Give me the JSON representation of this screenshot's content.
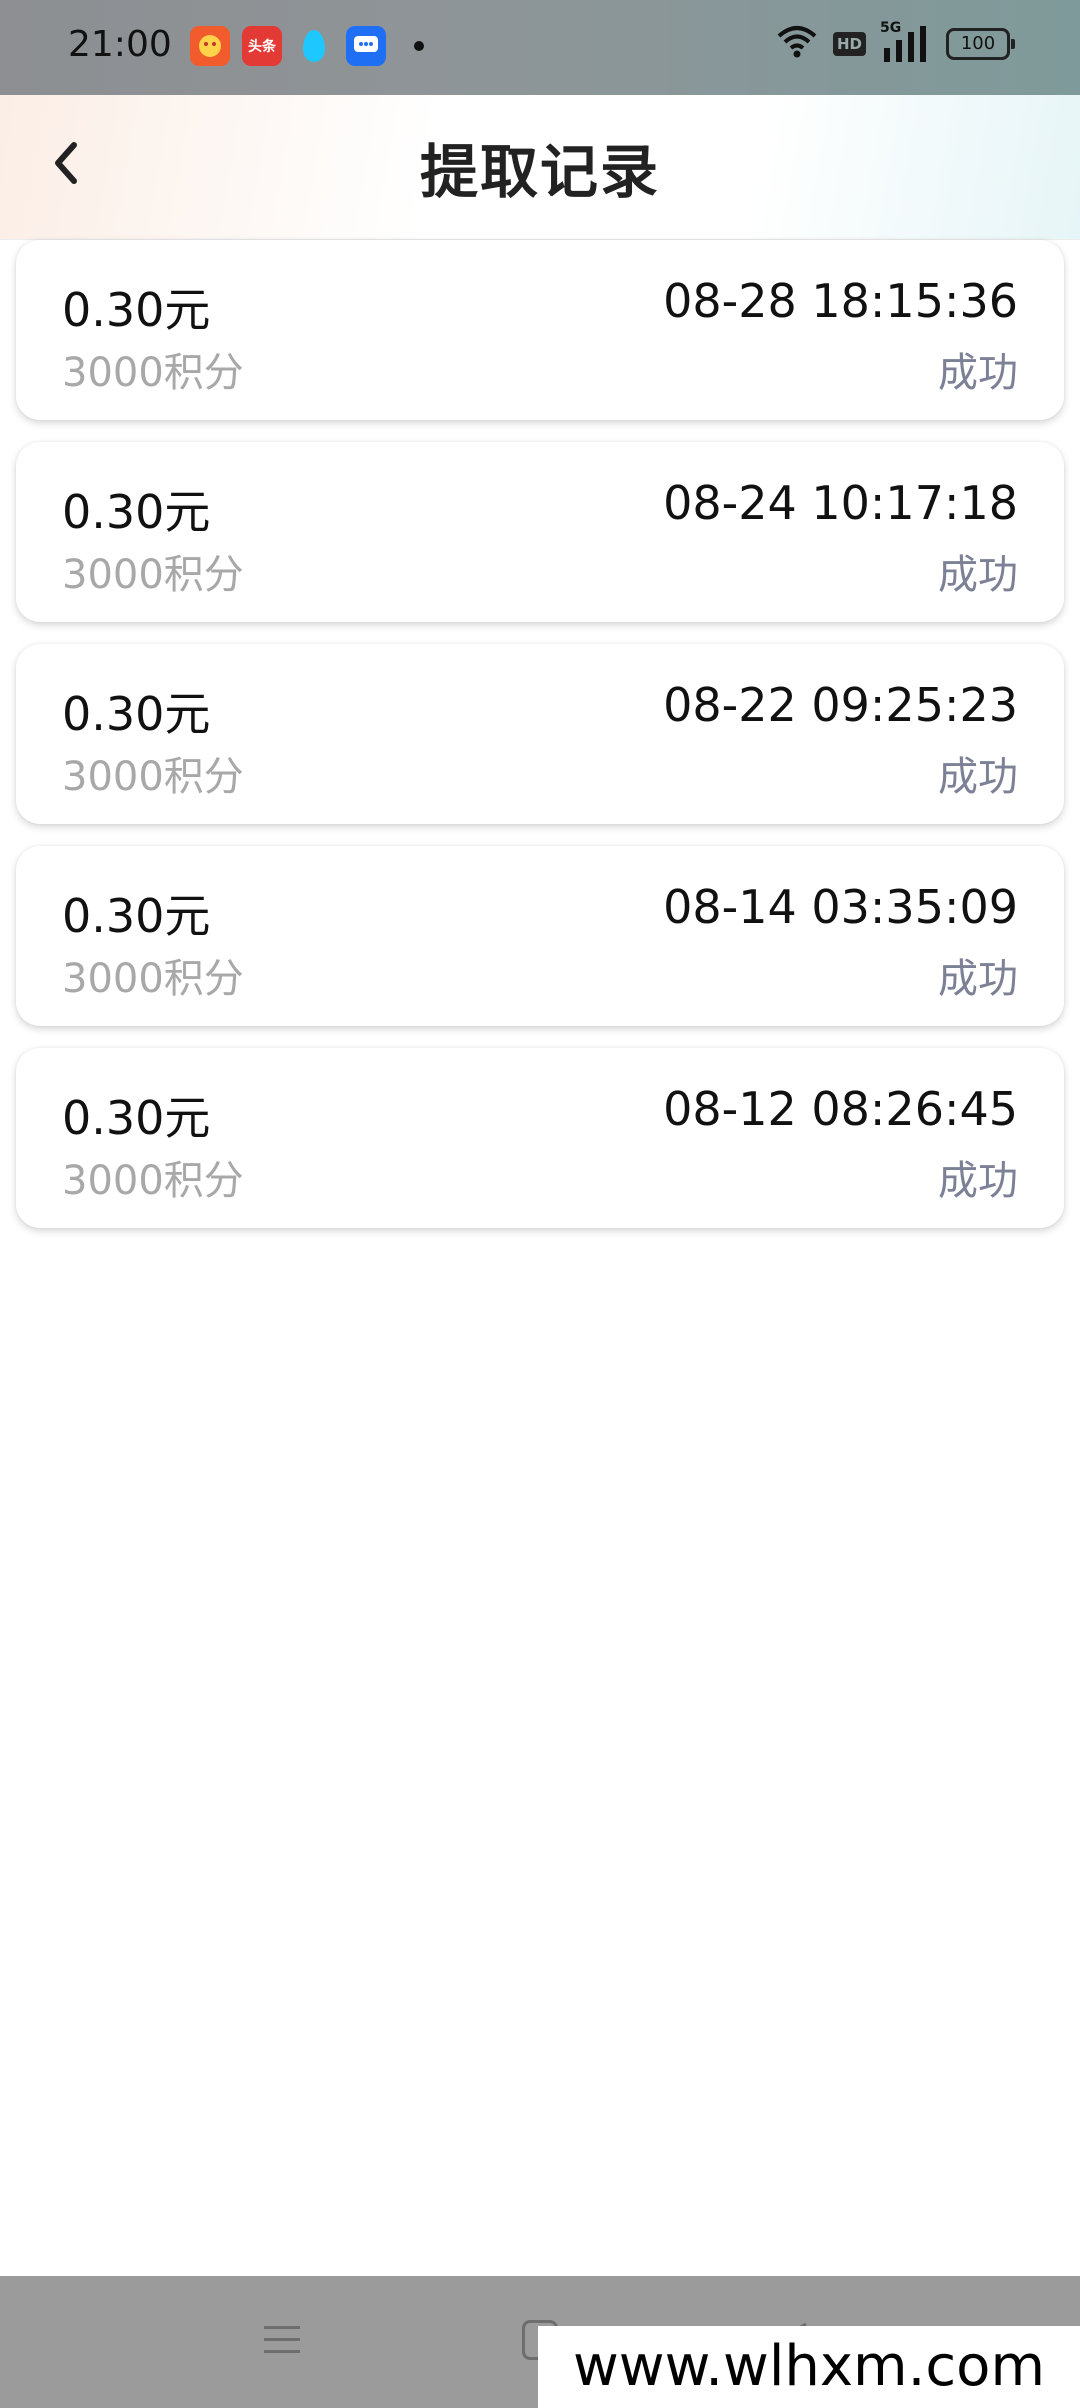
{
  "status_bar": {
    "time": "21:00",
    "notif_apps": [
      "app-icon",
      "toutiao-icon",
      "water-drop-icon",
      "message-icon"
    ],
    "app2_label": "头条",
    "hd": "HD",
    "network": "5G",
    "battery": "100"
  },
  "header": {
    "title": "提取记录",
    "back_icon": "chevron-left-icon"
  },
  "records": [
    {
      "amount": "0.30元",
      "points": "3000积分",
      "datetime": "08-28 18:15:36",
      "status": "成功"
    },
    {
      "amount": "0.30元",
      "points": "3000积分",
      "datetime": "08-24 10:17:18",
      "status": "成功"
    },
    {
      "amount": "0.30元",
      "points": "3000积分",
      "datetime": "08-22 09:25:23",
      "status": "成功"
    },
    {
      "amount": "0.30元",
      "points": "3000积分",
      "datetime": "08-14 03:35:09",
      "status": "成功"
    },
    {
      "amount": "0.30元",
      "points": "3000积分",
      "datetime": "08-12 08:26:45",
      "status": "成功"
    }
  ],
  "colors": {
    "points_text": "#a8a8a8",
    "status_text": "#7c8196",
    "nav_bar": "#9b9b9b"
  },
  "watermark": "www.wlhxm.com"
}
